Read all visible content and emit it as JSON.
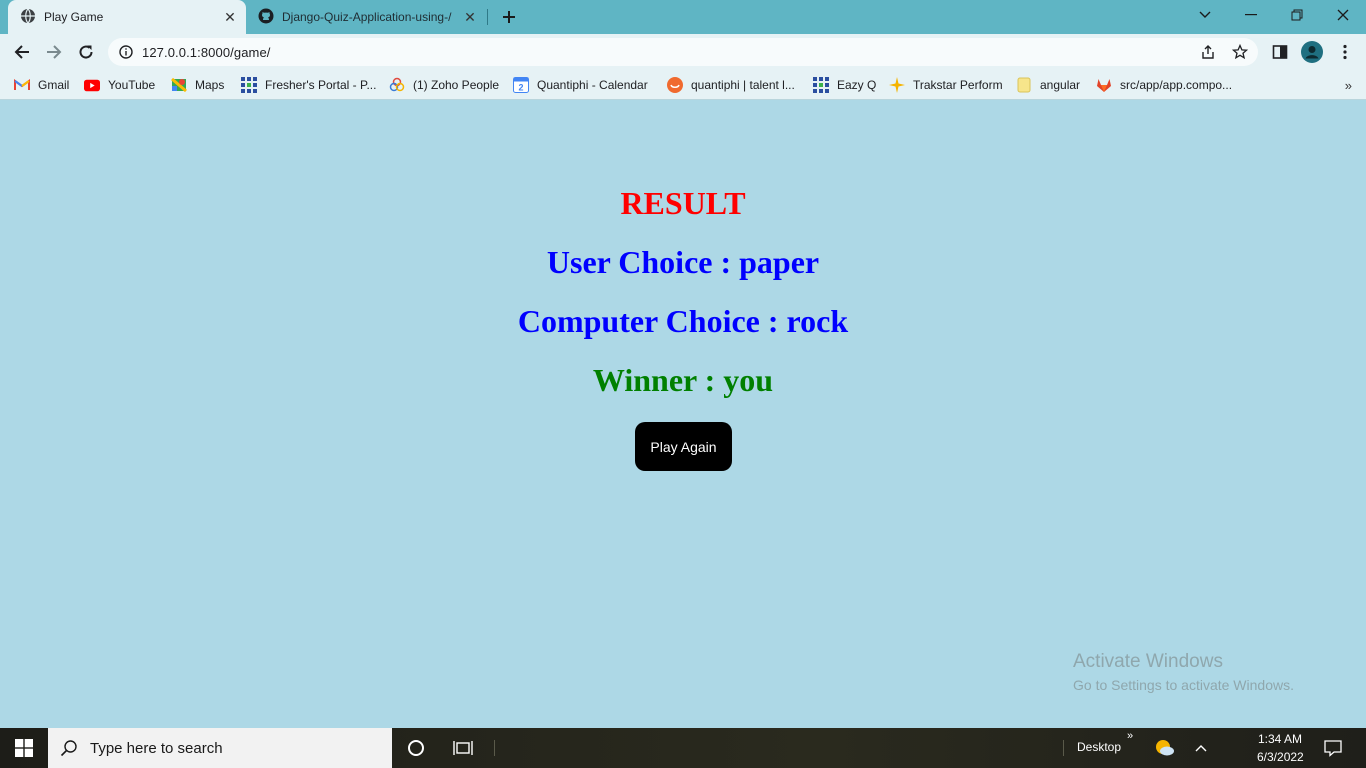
{
  "browser": {
    "tabs": [
      {
        "title": "Play Game",
        "active": true
      },
      {
        "title": "Django-Quiz-Application-using-/",
        "active": false
      }
    ],
    "url": "127.0.0.1:8000/game/",
    "bookmarks": [
      {
        "label": "Gmail",
        "icon": "gmail-icon"
      },
      {
        "label": "YouTube",
        "icon": "youtube-icon"
      },
      {
        "label": "Maps",
        "icon": "maps-icon"
      },
      {
        "label": "Fresher's Portal - P...",
        "icon": "grid-icon"
      },
      {
        "label": "(1) Zoho People",
        "icon": "zoho-icon"
      },
      {
        "label": "Quantiphi - Calendar",
        "icon": "calendar-icon"
      },
      {
        "label": "quantiphi | talent l...",
        "icon": "talent-icon"
      },
      {
        "label": "Eazy Q",
        "icon": "grid-icon"
      },
      {
        "label": "Trakstar Perform",
        "icon": "star-icon"
      },
      {
        "label": "angular",
        "icon": "folder-icon"
      },
      {
        "label": "src/app/app.compo...",
        "icon": "gitlab-icon"
      }
    ]
  },
  "page": {
    "result_heading": "RESULT",
    "user_choice": "User Choice : paper",
    "computer_choice": "Computer Choice : rock",
    "winner": "Winner : you",
    "play_again": "Play Again",
    "watermark_title": "Activate Windows",
    "watermark_sub": "Go to Settings to activate Windows."
  },
  "taskbar": {
    "search_placeholder": "Type here to search",
    "desktop_label": "Desktop",
    "time": "1:34 AM",
    "date": "6/3/2022"
  },
  "colors": {
    "page_bg": "#add8e6",
    "result": "#ff0000",
    "choices": "#0000ff",
    "winner": "#008000"
  }
}
